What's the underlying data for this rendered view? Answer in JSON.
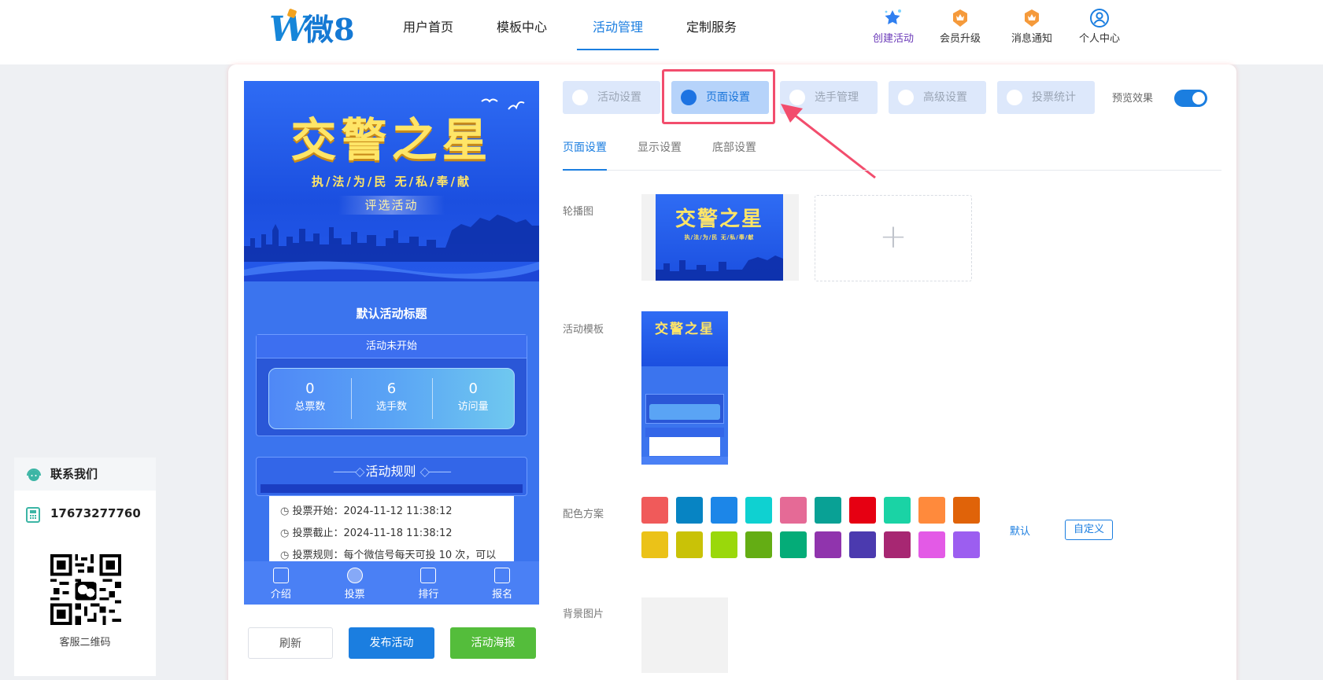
{
  "logo": {
    "mark": "W",
    "text": "微8"
  },
  "nav": [
    {
      "label": "用户首页"
    },
    {
      "label": "模板中心"
    },
    {
      "label": "活动管理"
    },
    {
      "label": "定制服务"
    }
  ],
  "tools": [
    {
      "label": "创建活动",
      "icon": "star-sparkle-icon"
    },
    {
      "label": "会员升级",
      "icon": "crown-badge-icon"
    },
    {
      "label": "消息通知",
      "icon": "crown-badge-icon"
    },
    {
      "label": "个人中心",
      "icon": "user-circle-icon"
    }
  ],
  "preview": {
    "banner_title": "交警之星",
    "banner_sub": "执/法/为/民  无/私/奉/献",
    "banner_tag": "评选活动",
    "activity_title": "默认活动标题",
    "status": "活动未开始",
    "stats": [
      {
        "value": "0",
        "label": "总票数"
      },
      {
        "value": "6",
        "label": "选手数"
      },
      {
        "value": "0",
        "label": "访问量"
      }
    ],
    "rules_title": "活动规则",
    "rules": [
      "投票开始：2024-11-12 11:38:12",
      "投票截止：2024-11-18 11:38:12",
      "投票规则：每个微信号每天可投 10 次，可以"
    ],
    "bottom_nav": [
      "介绍",
      "投票",
      "排行",
      "报名"
    ]
  },
  "buttons": {
    "refresh": "刷新",
    "publish": "发布活动",
    "poster": "活动海报"
  },
  "tabs": [
    {
      "label": "活动设置"
    },
    {
      "label": "页面设置"
    },
    {
      "label": "选手管理"
    },
    {
      "label": "高级设置"
    },
    {
      "label": "投票统计"
    }
  ],
  "preview_toggle": {
    "label": "预览效果",
    "on": true
  },
  "subtabs": [
    "页面设置",
    "显示设置",
    "底部设置"
  ],
  "fields": {
    "carousel": "轮播图",
    "template": "活动模板",
    "color_scheme": "配色方案",
    "background": "背景图片"
  },
  "upload_plus": "+",
  "colors": [
    "#f05a5a",
    "#0784c3",
    "#1c86e8",
    "#0fd1d1",
    "#e56a96",
    "#09a195",
    "#e60012",
    "#1ad3a5",
    "#ff8a3c",
    "#e06309",
    "#ebc218",
    "#c9c207",
    "#9ad80b",
    "#64ad14",
    "#04ac78",
    "#9034ad",
    "#4b3aaf",
    "#a72772",
    "#e35ae6",
    "#9c5ef0"
  ],
  "color_actions": {
    "default": "默认",
    "custom": "自定义"
  },
  "contact": {
    "title": "联系我们",
    "phone": "17673277760",
    "qr_label": "客服二维码"
  }
}
